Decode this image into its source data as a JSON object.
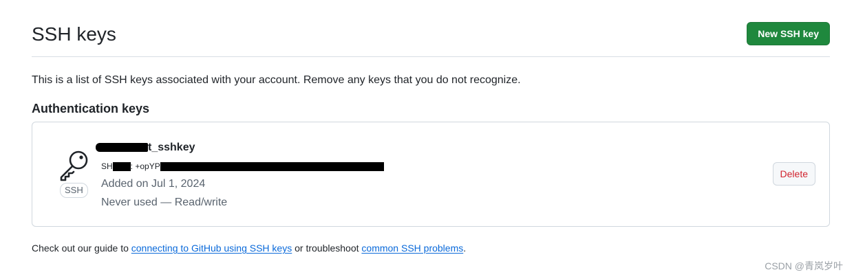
{
  "header": {
    "title": "SSH keys",
    "new_key_button": "New SSH key"
  },
  "description": "This is a list of SSH keys associated with your account. Remove any keys that you do not recognize.",
  "section_title": "Authentication keys",
  "key": {
    "title_suffix": "t_sshkey",
    "badge": "SSH",
    "fingerprint_prefix": "SH",
    "fingerprint_middle": ": +opYP",
    "added": "Added on Jul 1, 2024",
    "usage": "Never used — Read/write",
    "delete_button": "Delete",
    "icon": "key-icon"
  },
  "footer": {
    "text_1": "Check out our guide to ",
    "link_1": "connecting to GitHub using SSH keys",
    "text_2": " or troubleshoot ",
    "link_2": "common SSH problems",
    "text_3": "."
  },
  "watermark": "CSDN @青岚岁叶",
  "colors": {
    "primary_button": "#1f883d",
    "danger": "#d1242f",
    "link": "#0969da",
    "muted": "#59636e"
  }
}
